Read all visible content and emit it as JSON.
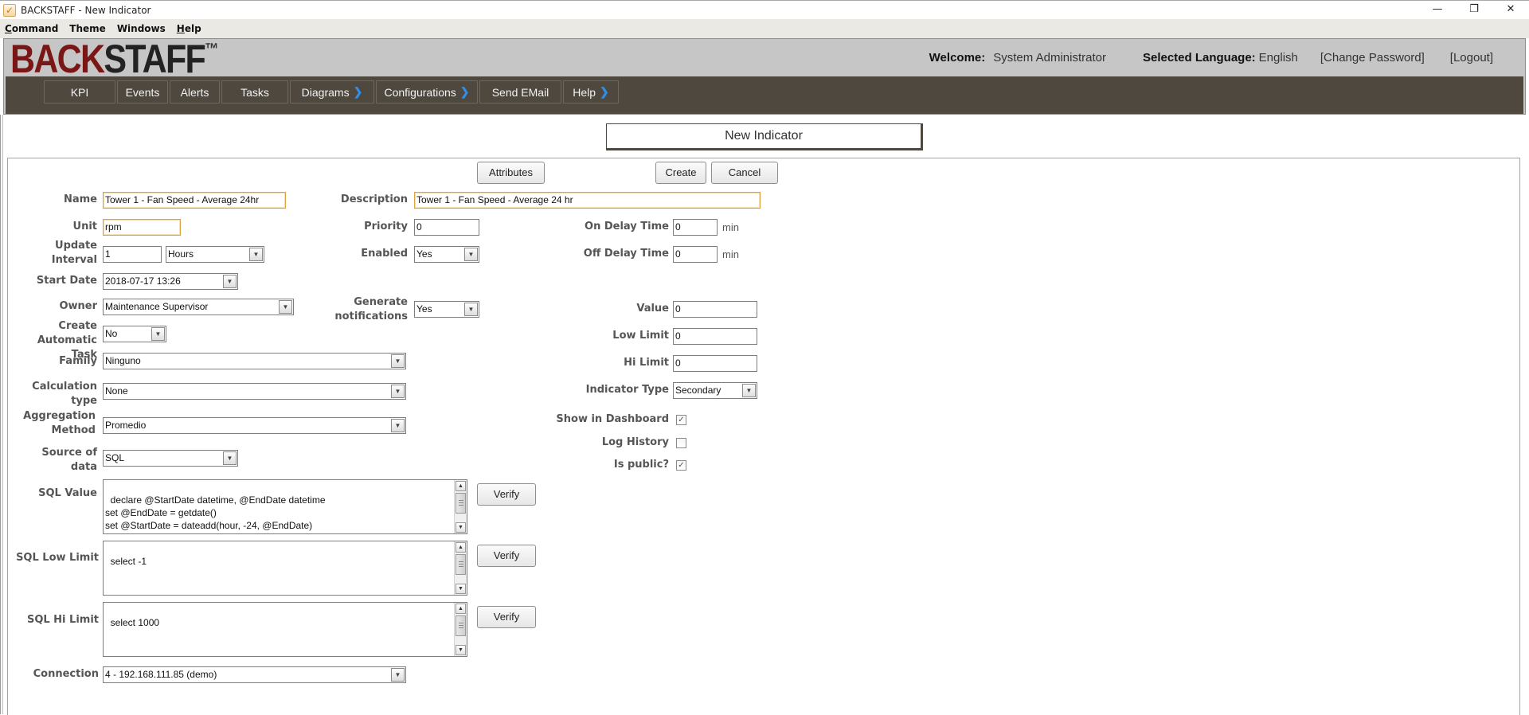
{
  "window": {
    "title": "BACKSTAFF - New Indicator",
    "app_icon": "checkmark-app-icon",
    "controls": {
      "minimize": "—",
      "restore": "❐",
      "close": "✕"
    }
  },
  "menubar": {
    "items": [
      {
        "label": "Command",
        "mnemonic": "C",
        "rest": "ommand"
      },
      {
        "label": "Theme"
      },
      {
        "label": "Windows"
      },
      {
        "label": "Help",
        "mnemonic": "H",
        "rest": "elp"
      }
    ]
  },
  "header": {
    "logo": {
      "part1": "BACK",
      "part2": "STAFF",
      "tm": "™"
    },
    "welcome_label": "Welcome:",
    "user_name": "System Administrator",
    "language_label": "Selected Language:",
    "language": "English",
    "change_password": "[Change Password]",
    "logout": "[Logout]",
    "colors": {
      "logo_red": "#7a1616",
      "nav_bg": "#4e483f",
      "chevron": "#2f8fe8"
    }
  },
  "nav": {
    "items": [
      {
        "label": "KPI",
        "has_submenu": false
      },
      {
        "label": "Events",
        "has_submenu": false
      },
      {
        "label": "Alerts",
        "has_submenu": false
      },
      {
        "label": "Tasks",
        "has_submenu": false
      },
      {
        "label": "Diagrams",
        "has_submenu": true
      },
      {
        "label": "Configurations",
        "has_submenu": true
      },
      {
        "label": "Send EMail",
        "has_submenu": false
      },
      {
        "label": "Help",
        "has_submenu": true
      }
    ],
    "chevron_glyph": "❯"
  },
  "page": {
    "title": "New Indicator",
    "buttons": {
      "attributes": "Attributes",
      "create": "Create",
      "cancel": "Cancel",
      "verify": "Verify"
    }
  },
  "form": {
    "name": {
      "label": "Name",
      "value": "Tower 1 - Fan Speed - Average 24hr"
    },
    "description": {
      "label": "Description",
      "value": "Tower 1 - Fan Speed - Average 24 hr"
    },
    "unit": {
      "label": "Unit",
      "value": "rpm"
    },
    "priority": {
      "label": "Priority",
      "value": "0"
    },
    "on_delay": {
      "label": "On Delay Time",
      "value": "0",
      "unit": "min"
    },
    "update_interval": {
      "label1": "Update",
      "label2": "Interval",
      "value": "1",
      "period": "Hours"
    },
    "enabled": {
      "label": "Enabled",
      "value": "Yes"
    },
    "off_delay": {
      "label": "Off Delay Time",
      "value": "0",
      "unit": "min"
    },
    "start_date": {
      "label": "Start Date",
      "value": "2018-07-17 13:26"
    },
    "owner": {
      "label": "Owner",
      "value": "Maintenance Supervisor"
    },
    "generate_notifications": {
      "label1": "Generate",
      "label2": "notifications",
      "value": "Yes"
    },
    "value": {
      "label": "Value",
      "value": "0"
    },
    "create_task": {
      "label1": "Create",
      "label2": "Automatic Task",
      "value": "No"
    },
    "low_limit": {
      "label": "Low Limit",
      "value": "0"
    },
    "family": {
      "label": "Family",
      "value": "Ninguno"
    },
    "hi_limit": {
      "label": "Hi Limit",
      "value": "0"
    },
    "calculation_type": {
      "label1": "Calculation",
      "label2": "type",
      "value": "None"
    },
    "indicator_type": {
      "label": "Indicator Type",
      "value": "Secondary"
    },
    "aggregation": {
      "label1": "Aggregation",
      "label2": "Method",
      "value": "Promedio"
    },
    "show_dashboard": {
      "label": "Show in Dashboard",
      "checked": true
    },
    "log_history": {
      "label": "Log History",
      "checked": false
    },
    "is_public": {
      "label": "Is public?",
      "checked": true
    },
    "source": {
      "label1": "Source of",
      "label2": "data",
      "value": "SQL"
    },
    "sql_value": {
      "label": "SQL Value",
      "value": "declare @StartDate datetime, @EndDate datetime\nset @EndDate = getdate()\nset @StartDate = dateadd(hour, -24, @EndDate)\nexec  sp_TagHistorianQuery @StartDate, @EndDate,"
    },
    "sql_low": {
      "label": "SQL Low Limit",
      "value": "select -1"
    },
    "sql_hi": {
      "label": "SQL Hi Limit",
      "value": "select 1000"
    },
    "connection": {
      "label": "Connection",
      "value": "4 - 192.168.111.85 (demo)"
    },
    "check_glyph": "✓",
    "dropdown_glyph": "▼",
    "scroll_up_glyph": "▲"
  }
}
